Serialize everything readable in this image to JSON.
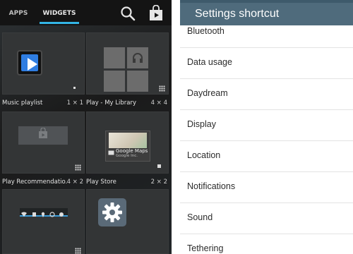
{
  "widget_picker": {
    "tabs": {
      "apps": "APPS",
      "widgets": "WIDGETS"
    },
    "icons": {
      "search": "search-icon",
      "store": "play-store-icon"
    },
    "widgets": [
      {
        "label": "Music playlist",
        "size": "1 × 1"
      },
      {
        "label": "Play - My Library",
        "size": "4 × 4"
      },
      {
        "label": "Play Recommendatio...",
        "size": "4 × 2"
      },
      {
        "label": "Play Store",
        "size": "2 × 2"
      },
      {
        "label": "",
        "size": ""
      },
      {
        "label": "",
        "size": ""
      }
    ],
    "play_store_preview": {
      "title": "Google Maps",
      "subtitle": "Google Inc."
    },
    "accent": "#33b5e5"
  },
  "settings_shortcut": {
    "title": "Settings shortcut",
    "header_color": "#4f6b7c",
    "items": [
      "Bluetooth",
      "Data usage",
      "Daydream",
      "Display",
      "Location",
      "Notifications",
      "Sound",
      "Tethering"
    ]
  }
}
